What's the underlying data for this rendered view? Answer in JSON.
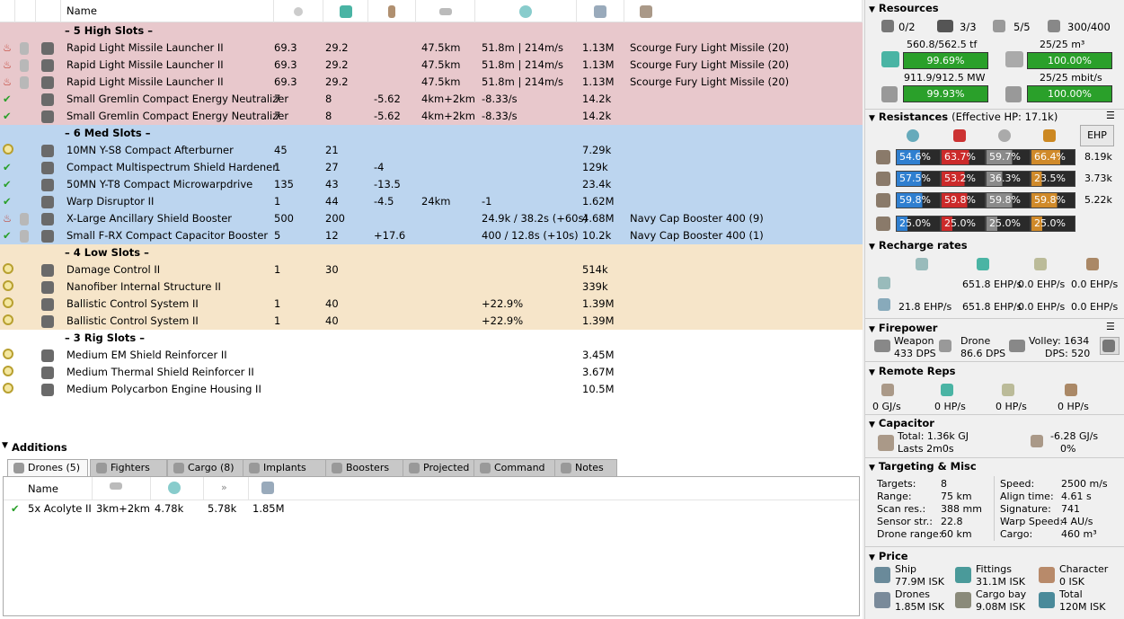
{
  "fitting": {
    "headers": {
      "name": "Name"
    },
    "sections": [
      {
        "kind": "hi",
        "title": "– 5 High Slots –",
        "rows": [
          {
            "state": "overheat",
            "name": "Rapid Light Missile Launcher II",
            "c1": "69.3",
            "c2": "29.2",
            "c3": "",
            "c4": "47.5km",
            "c5": "51.8m | 214m/s",
            "c6": "1.13M",
            "c7": "Scourge Fury Light Missile (20)"
          },
          {
            "state": "overheat",
            "name": "Rapid Light Missile Launcher II",
            "c1": "69.3",
            "c2": "29.2",
            "c3": "",
            "c4": "47.5km",
            "c5": "51.8m | 214m/s",
            "c6": "1.13M",
            "c7": "Scourge Fury Light Missile (20)"
          },
          {
            "state": "overheat",
            "name": "Rapid Light Missile Launcher II",
            "c1": "69.3",
            "c2": "29.2",
            "c3": "",
            "c4": "47.5km",
            "c5": "51.8m | 214m/s",
            "c6": "1.13M",
            "c7": "Scourge Fury Light Missile (20)"
          },
          {
            "state": "active",
            "name": "Small Gremlin Compact Energy Neutralizer",
            "c1": "7",
            "c2": "8",
            "c3": "-5.62",
            "c4": "4km+2km",
            "c5": "-8.33/s",
            "c6": "14.2k",
            "c7": ""
          },
          {
            "state": "active",
            "name": "Small Gremlin Compact Energy Neutralizer",
            "c1": "7",
            "c2": "8",
            "c3": "-5.62",
            "c4": "4km+2km",
            "c5": "-8.33/s",
            "c6": "14.2k",
            "c7": ""
          }
        ]
      },
      {
        "kind": "med",
        "title": "– 6 Med Slots –",
        "rows": [
          {
            "state": "online",
            "name": "10MN Y-S8 Compact Afterburner",
            "c1": "45",
            "c2": "21",
            "c3": "",
            "c4": "",
            "c5": "",
            "c6": "7.29k",
            "c7": ""
          },
          {
            "state": "active",
            "name": "Compact Multispectrum Shield Hardener",
            "c1": "1",
            "c2": "27",
            "c3": "-4",
            "c4": "",
            "c5": "",
            "c6": "129k",
            "c7": ""
          },
          {
            "state": "active",
            "name": "50MN Y-T8 Compact Microwarpdrive",
            "c1": "135",
            "c2": "43",
            "c3": "-13.5",
            "c4": "",
            "c5": "",
            "c6": "23.4k",
            "c7": ""
          },
          {
            "state": "active",
            "name": "Warp Disruptor II",
            "c1": "1",
            "c2": "44",
            "c3": "-4.5",
            "c4": "24km",
            "c5": "-1",
            "c6": "1.62M",
            "c7": ""
          },
          {
            "state": "overheat",
            "name": "X-Large Ancillary Shield Booster",
            "c1": "500",
            "c2": "200",
            "c3": "",
            "c4": "",
            "c5": "24.9k / 38.2s (+60s)",
            "c6": "4.68M",
            "c7": "Navy Cap Booster 400 (9)"
          },
          {
            "state": "active",
            "name": "Small F-RX Compact Capacitor Booster",
            "c1": "5",
            "c2": "12",
            "c3": "+17.6",
            "c4": "",
            "c5": "400 / 12.8s (+10s)",
            "c6": "10.2k",
            "c7": "Navy Cap Booster 400 (1)"
          }
        ]
      },
      {
        "kind": "low",
        "title": "– 4 Low Slots –",
        "rows": [
          {
            "state": "online",
            "name": "Damage Control II",
            "c1": "1",
            "c2": "30",
            "c3": "",
            "c4": "",
            "c5": "",
            "c6": "514k",
            "c7": ""
          },
          {
            "state": "online",
            "name": "Nanofiber Internal Structure II",
            "c1": "",
            "c2": "",
            "c3": "",
            "c4": "",
            "c5": "",
            "c6": "339k",
            "c7": ""
          },
          {
            "state": "online",
            "name": "Ballistic Control System II",
            "c1": "1",
            "c2": "40",
            "c3": "",
            "c4": "",
            "c5": "+22.9%",
            "c6": "1.39M",
            "c7": ""
          },
          {
            "state": "online",
            "name": "Ballistic Control System II",
            "c1": "1",
            "c2": "40",
            "c3": "",
            "c4": "",
            "c5": "+22.9%",
            "c6": "1.39M",
            "c7": ""
          }
        ]
      },
      {
        "kind": "rig",
        "title": "– 3 Rig Slots –",
        "rows": [
          {
            "state": "online",
            "name": "Medium EM Shield Reinforcer II",
            "c1": "",
            "c2": "",
            "c3": "",
            "c4": "",
            "c5": "",
            "c6": "3.45M",
            "c7": ""
          },
          {
            "state": "online",
            "name": "Medium Thermal Shield Reinforcer II",
            "c1": "",
            "c2": "",
            "c3": "",
            "c4": "",
            "c5": "",
            "c6": "3.67M",
            "c7": ""
          },
          {
            "state": "online",
            "name": "Medium Polycarbon Engine Housing II",
            "c1": "",
            "c2": "",
            "c3": "",
            "c4": "",
            "c5": "",
            "c6": "10.5M",
            "c7": ""
          }
        ]
      }
    ]
  },
  "additions": {
    "title": "Additions",
    "tabs": [
      "Drones (5)",
      "Fighters",
      "Cargo (8)",
      "Implants",
      "Boosters",
      "Projected",
      "Command",
      "Notes"
    ],
    "drones_header": "Name",
    "drone": {
      "name": "5x Acolyte II",
      "range": "3km+2km",
      "c2": "4.78k",
      "c3": "5.78k",
      "c4": "1.85M"
    }
  },
  "resources": {
    "title": "Resources",
    "top": [
      "0/2",
      "3/3",
      "5/5",
      "300/400"
    ],
    "cpu_label": "560.8/562.5 tf",
    "cpu_pct": "99.69%",
    "pg_label": "911.9/912.5 MW",
    "pg_pct": "99.93%",
    "bay_label": "25/25 m³",
    "bay_pct": "100.00%",
    "bw_label": "25/25 mbit/s",
    "bw_pct": "100.00%"
  },
  "resistances": {
    "title": "Resistances",
    "ehp": "(Effective HP: 17.1k)",
    "ehp_button": "EHP",
    "rows": [
      {
        "vals": [
          "54.6%",
          "63.7%",
          "59.7%",
          "66.4%"
        ],
        "hp": "8.19k",
        "fills": [
          0.546,
          0.637,
          0.597,
          0.664
        ]
      },
      {
        "vals": [
          "57.5%",
          "53.2%",
          "36.3%",
          "23.5%"
        ],
        "hp": "3.73k",
        "fills": [
          0.575,
          0.532,
          0.363,
          0.235
        ]
      },
      {
        "vals": [
          "59.8%",
          "59.8%",
          "59.8%",
          "59.8%"
        ],
        "hp": "5.22k",
        "fills": [
          0.598,
          0.598,
          0.598,
          0.598
        ]
      },
      {
        "vals": [
          "25.0%",
          "25.0%",
          "25.0%",
          "25.0%"
        ],
        "hp": "",
        "fills": [
          0.25,
          0.25,
          0.25,
          0.25
        ]
      }
    ]
  },
  "recharge": {
    "title": "Recharge rates",
    "row1": [
      "",
      "651.8 EHP/s",
      "0.0 EHP/s",
      "0.0 EHP/s"
    ],
    "row2": [
      "21.8 EHP/s",
      "651.8 EHP/s",
      "0.0 EHP/s",
      "0.0 EHP/s"
    ]
  },
  "firepower": {
    "title": "Firepower",
    "weapon_label": "Weapon",
    "weapon_dps": "433 DPS",
    "drone_label": "Drone",
    "drone_dps": "86.6 DPS",
    "volley": "Volley: 1634",
    "dps": "DPS: 520"
  },
  "remote": {
    "title": "Remote Reps",
    "vals": [
      "0 GJ/s",
      "0 HP/s",
      "0 HP/s",
      "0 HP/s"
    ]
  },
  "capacitor": {
    "title": "Capacitor",
    "total": "Total: 1.36k GJ",
    "lasts": "Lasts 2m0s",
    "rate": "-6.28 GJ/s",
    "pct": "0%"
  },
  "targeting": {
    "title": "Targeting & Misc",
    "left": [
      [
        "Targets:",
        "8"
      ],
      [
        "Range:",
        "75 km"
      ],
      [
        "Scan res.:",
        "388 mm"
      ],
      [
        "Sensor str.:",
        "22.8"
      ],
      [
        "Drone range:",
        "60 km"
      ]
    ],
    "right": [
      [
        "Speed:",
        "2500 m/s"
      ],
      [
        "Align time:",
        "4.61 s"
      ],
      [
        "Signature:",
        "741"
      ],
      [
        "Warp Speed:",
        "4 AU/s"
      ],
      [
        "Cargo:",
        "460 m³"
      ]
    ]
  },
  "price": {
    "title": "Price",
    "items": [
      [
        "Ship",
        "77.9M ISK"
      ],
      [
        "Fittings",
        "31.1M ISK"
      ],
      [
        "Character",
        "0 ISK"
      ],
      [
        "Drones",
        "1.85M ISK"
      ],
      [
        "Cargo bay",
        "9.08M ISK"
      ],
      [
        "Total",
        "120M ISK"
      ]
    ]
  },
  "colors": {
    "hi": "#e8c8cc",
    "med": "#bcd5ef",
    "low": "#f6e5c9",
    "green": "#2aa02a",
    "em": "#2f7fd0",
    "therm": "#cc2a2a",
    "kin": "#8a8a8a",
    "exp": "#d08a2a"
  }
}
